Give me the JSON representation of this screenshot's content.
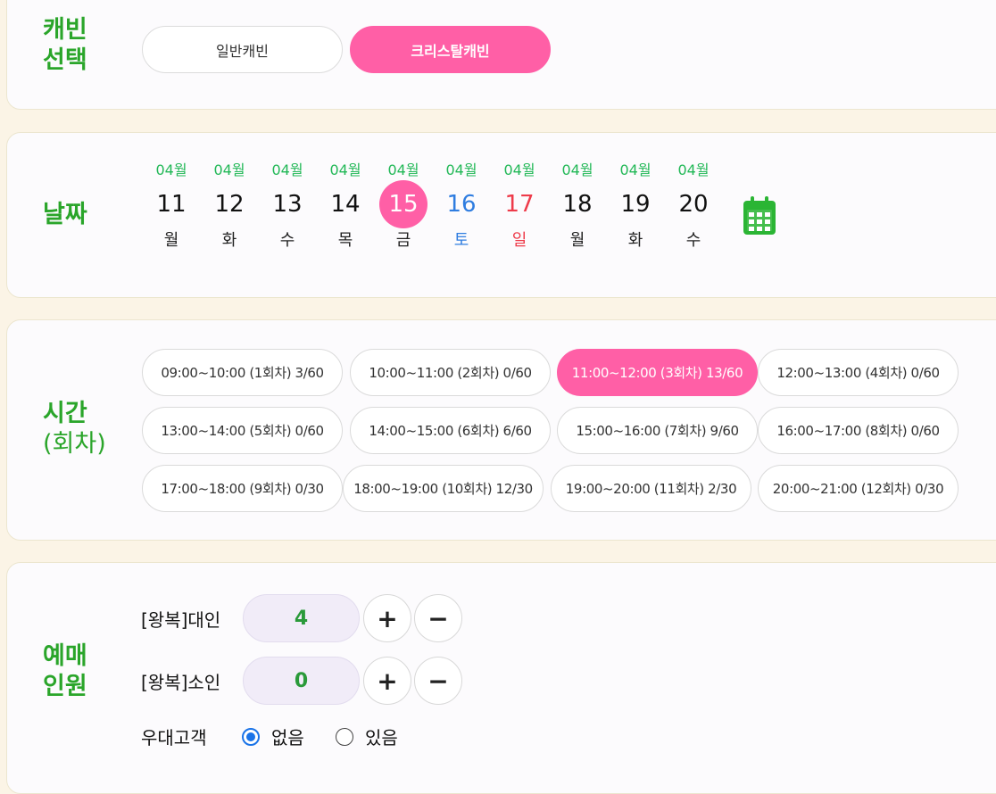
{
  "cabin": {
    "label_line1": "캐빈",
    "label_line2": "선택",
    "options": [
      {
        "label": "일반캐빈",
        "selected": false
      },
      {
        "label": "크리스탈캐빈",
        "selected": true
      }
    ]
  },
  "date": {
    "label": "날짜",
    "calendar_icon": "calendar-icon",
    "days": [
      {
        "month": "04월",
        "day": "11",
        "weekday": "월",
        "type": "weekday",
        "selected": false
      },
      {
        "month": "04월",
        "day": "12",
        "weekday": "화",
        "type": "weekday",
        "selected": false
      },
      {
        "month": "04월",
        "day": "13",
        "weekday": "수",
        "type": "weekday",
        "selected": false
      },
      {
        "month": "04월",
        "day": "14",
        "weekday": "목",
        "type": "weekday",
        "selected": false
      },
      {
        "month": "04월",
        "day": "15",
        "weekday": "금",
        "type": "weekday",
        "selected": true
      },
      {
        "month": "04월",
        "day": "16",
        "weekday": "토",
        "type": "saturday",
        "selected": false
      },
      {
        "month": "04월",
        "day": "17",
        "weekday": "일",
        "type": "sunday",
        "selected": false
      },
      {
        "month": "04월",
        "day": "18",
        "weekday": "월",
        "type": "weekday",
        "selected": false
      },
      {
        "month": "04월",
        "day": "19",
        "weekday": "화",
        "type": "weekday",
        "selected": false
      },
      {
        "month": "04월",
        "day": "20",
        "weekday": "수",
        "type": "weekday",
        "selected": false
      }
    ]
  },
  "time": {
    "label_line1": "시간",
    "label_line2": "(회차)",
    "slots": [
      {
        "label": "09:00~10:00 (1회차) 3/60",
        "selected": false
      },
      {
        "label": "10:00~11:00 (2회차) 0/60",
        "selected": false
      },
      {
        "label": "11:00~12:00 (3회차) 13/60",
        "selected": true
      },
      {
        "label": "12:00~13:00 (4회차) 0/60",
        "selected": false
      },
      {
        "label": "13:00~14:00 (5회차) 0/60",
        "selected": false
      },
      {
        "label": "14:00~15:00 (6회차) 6/60",
        "selected": false
      },
      {
        "label": "15:00~16:00 (7회차) 9/60",
        "selected": false
      },
      {
        "label": "16:00~17:00 (8회차) 0/60",
        "selected": false
      },
      {
        "label": "17:00~18:00 (9회차) 0/30",
        "selected": false
      },
      {
        "label": "18:00~19:00 (10회차) 12/30",
        "selected": false
      },
      {
        "label": "19:00~20:00 (11회차) 2/30",
        "selected": false
      },
      {
        "label": "20:00~21:00 (12회차) 0/30",
        "selected": false
      }
    ]
  },
  "people": {
    "label_line1": "예매",
    "label_line2": "인원",
    "adult_label": "[왕복]대인",
    "adult_count": "4",
    "child_label": "[왕복]소인",
    "child_count": "0",
    "plus": "+",
    "minus": "−",
    "discount_label": "우대고객",
    "discount_none": "없음",
    "discount_yes": "있음"
  },
  "colors": {
    "accent_pink": "#ff5fa6",
    "label_green": "#2aa52a",
    "month_green": "#22b857",
    "saturday_blue": "#2f7de0",
    "sunday_red": "#ee3b4a"
  }
}
